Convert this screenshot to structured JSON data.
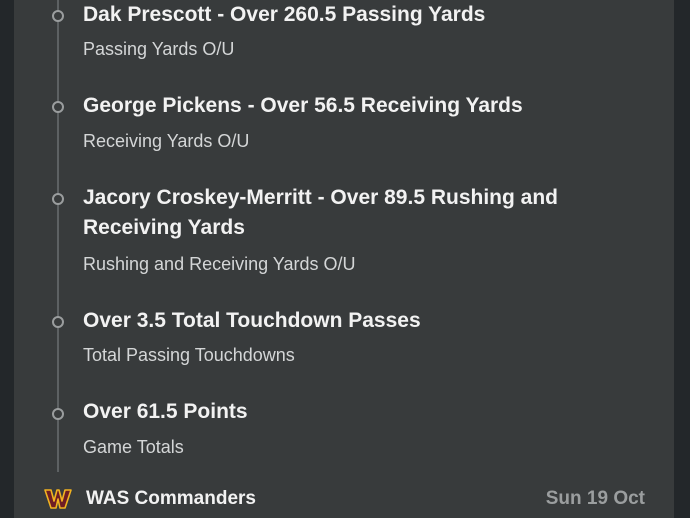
{
  "legs": [
    {
      "title": "Dak Prescott - Over 260.5 Passing Yards",
      "market": "Passing Yards O/U"
    },
    {
      "title": "George Pickens - Over 56.5 Receiving Yards",
      "market": "Receiving Yards O/U"
    },
    {
      "title": "Jacory Croskey-Merritt - Over 89.5 Rushing and Receiving Yards",
      "market": "Rushing and Receiving Yards O/U"
    },
    {
      "title": "Over 3.5 Total Touchdown Passes",
      "market": "Total Passing Touchdowns"
    },
    {
      "title": "Over 61.5 Points",
      "market": "Game Totals"
    }
  ],
  "footer": {
    "team_logo": "washington-commanders-logo",
    "team_name": "WAS Commanders",
    "date": "Sun 19 Oct"
  },
  "colors": {
    "card_background": "#383b3c",
    "logo_primary": "#6f1d24",
    "logo_accent": "#f2b320"
  }
}
